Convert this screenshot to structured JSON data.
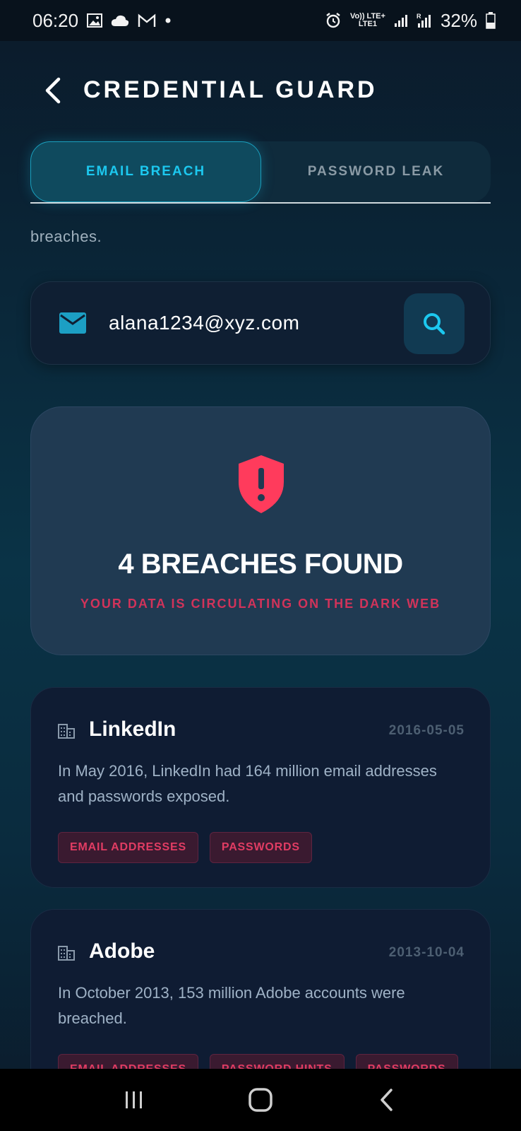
{
  "status_bar": {
    "time": "06:20",
    "network_top": "Vo)) LTE+",
    "network_bottom": "LTE1",
    "battery": "32%"
  },
  "header": {
    "title": "CREDENTIAL GUARD"
  },
  "tabs": [
    {
      "label": "EMAIL BREACH",
      "active": true
    },
    {
      "label": "PASSWORD LEAK",
      "active": false
    }
  ],
  "intro_text": "breaches.",
  "search": {
    "email_value": "alana1234@xyz.com"
  },
  "result": {
    "title": "4 BREACHES FOUND",
    "subtitle": "YOUR DATA IS CIRCULATING ON THE DARK WEB"
  },
  "breaches": [
    {
      "name": "LinkedIn",
      "date": "2016-05-05",
      "description": "In May 2016, LinkedIn had 164 million email addresses and passwords exposed.",
      "tags": [
        "EMAIL ADDRESSES",
        "PASSWORDS"
      ]
    },
    {
      "name": "Adobe",
      "date": "2013-10-04",
      "description": "In October 2013, 153 million Adobe accounts were breached.",
      "tags": [
        "EMAIL ADDRESSES",
        "PASSWORD HINTS",
        "PASSWORDS"
      ]
    }
  ],
  "colors": {
    "accent": "#1cc8ef",
    "danger": "#ff3b5c",
    "card": "#0f1c33"
  }
}
